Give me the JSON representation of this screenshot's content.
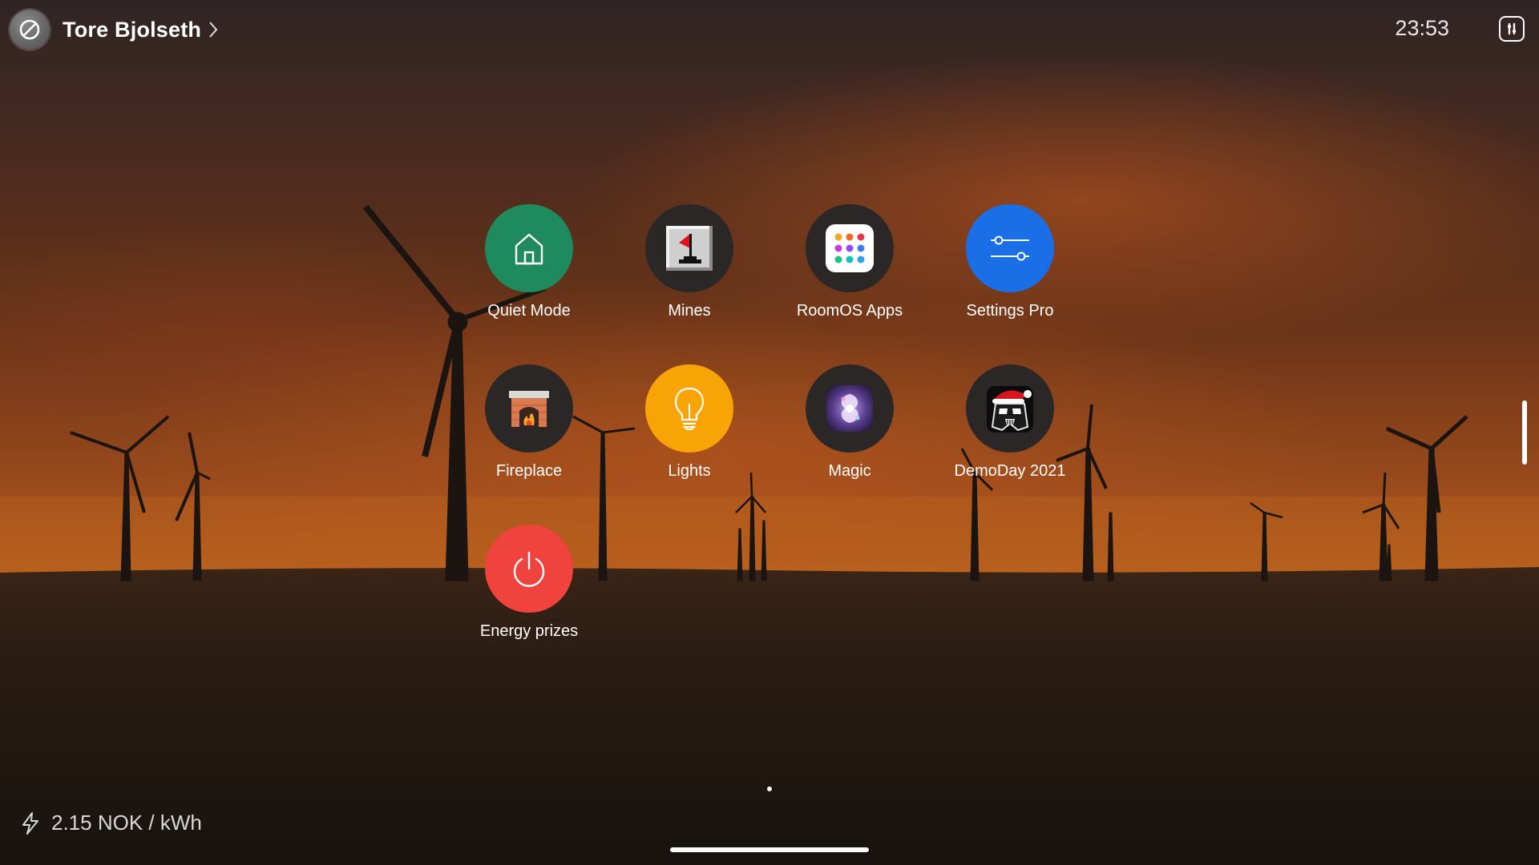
{
  "header": {
    "user_name": "Tore Bjolseth",
    "avatar_icon": "do-not-disturb-icon",
    "time": "23:53",
    "control_panel_icon": "control-panel-icon"
  },
  "apps": [
    {
      "label": "Quiet Mode",
      "icon": "home-icon",
      "color": "#1e8a5e"
    },
    {
      "label": "Mines",
      "icon": "minesweeper-flag-icon",
      "color": "#2b2727"
    },
    {
      "label": "RoomOS Apps",
      "icon": "app-grid-icon",
      "color": "#2b2727"
    },
    {
      "label": "Settings Pro",
      "icon": "sliders-icon",
      "color": "#1a6ee6"
    },
    {
      "label": "Fireplace",
      "icon": "fireplace-icon",
      "color": "#2b2727"
    },
    {
      "label": "Lights",
      "icon": "lightbulb-icon",
      "color": "#f9a406"
    },
    {
      "label": "Magic",
      "icon": "magic-swirl-icon",
      "color": "#2b2727"
    },
    {
      "label": "DemoDay 2021",
      "icon": "darth-vader-santa-icon",
      "color": "#2b2727"
    },
    {
      "label": "Energy prizes",
      "icon": "power-icon",
      "color": "#f0433d"
    }
  ],
  "footer": {
    "energy_price": "2.15 NOK / kWh",
    "energy_icon": "lightning-icon"
  }
}
